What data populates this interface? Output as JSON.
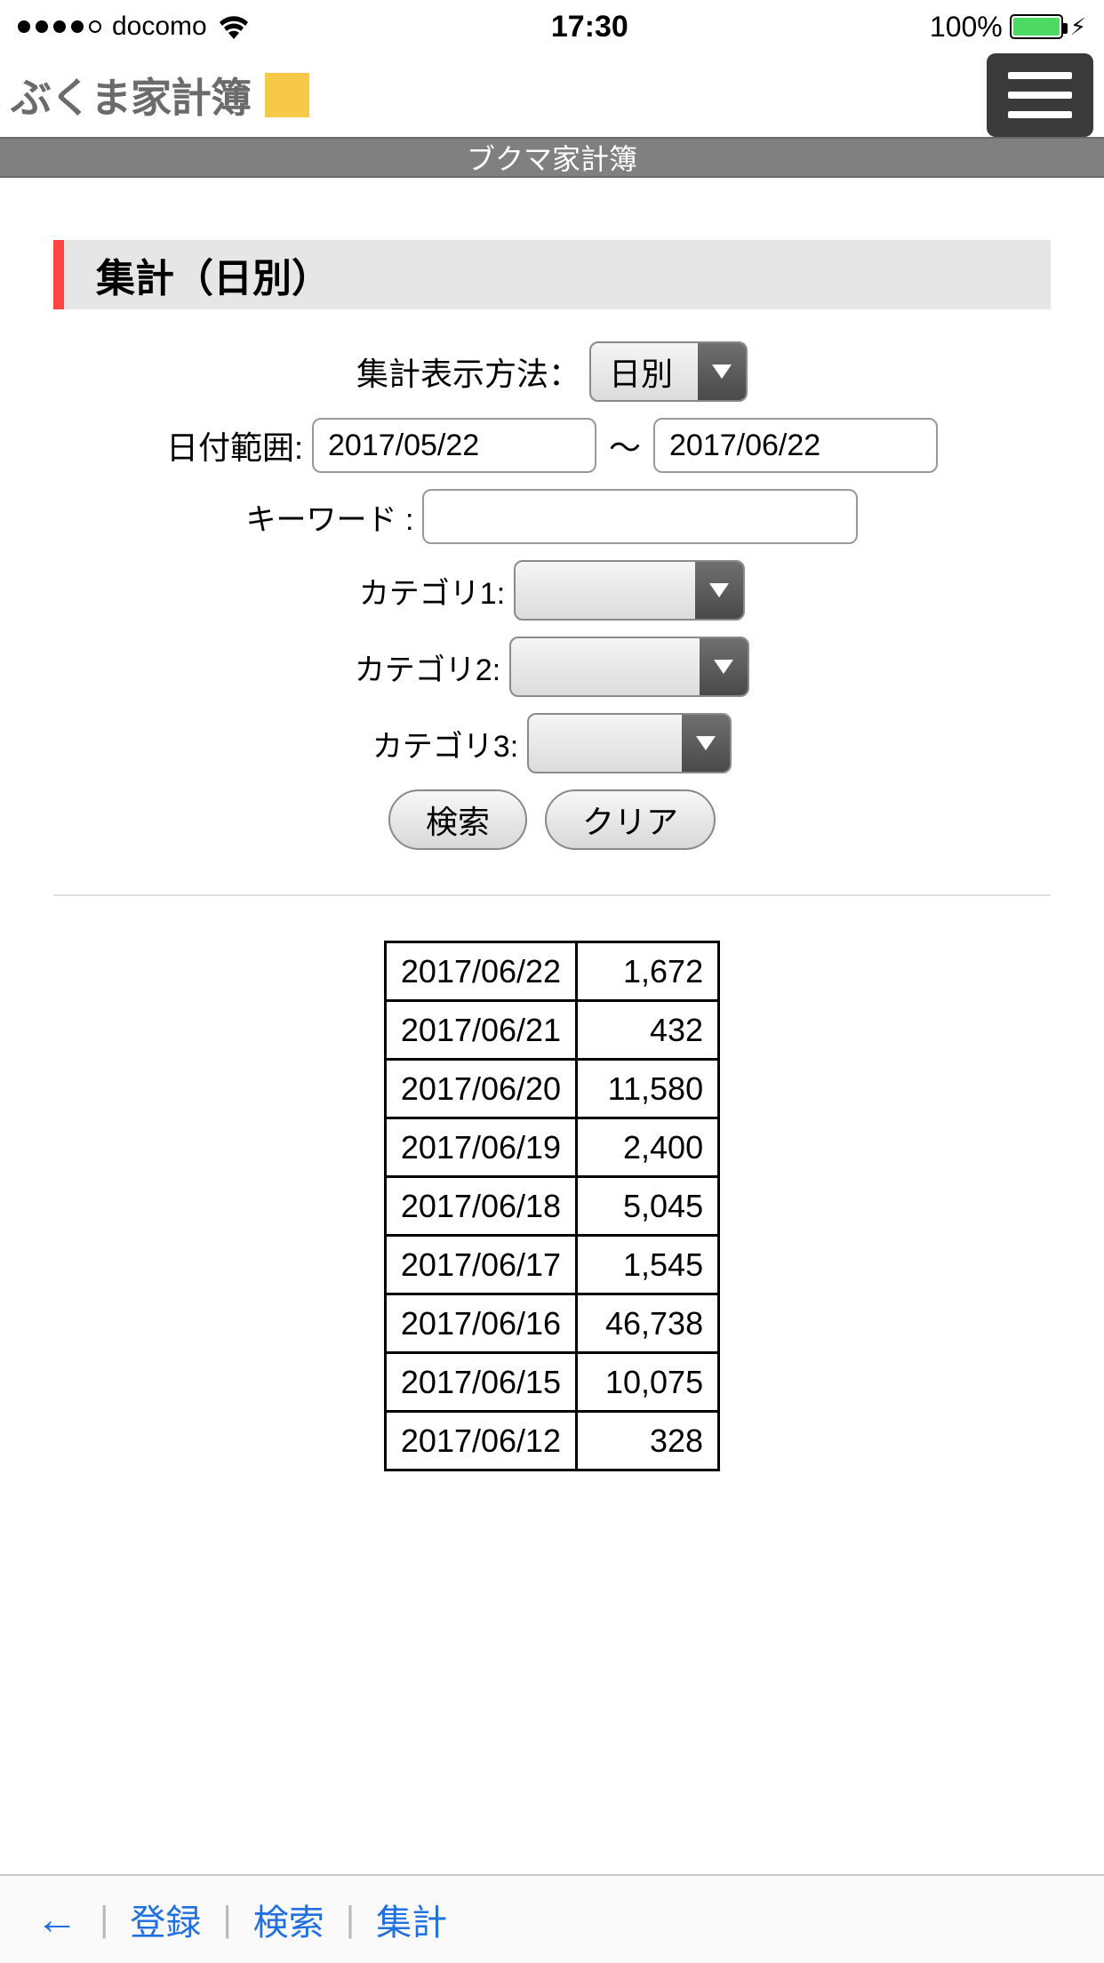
{
  "status": {
    "carrier": "docomo",
    "time": "17:30",
    "battery_pct": "100%"
  },
  "header": {
    "app_title": "ぶくま家計簿"
  },
  "gray_bar": {
    "title": "ブクマ家計簿"
  },
  "section": {
    "title": "集計（日別）"
  },
  "form": {
    "display_method_label": "集計表示方法：",
    "display_method_value": "日別",
    "date_range_label": "日付範囲:",
    "date_from": "2017/05/22",
    "date_tilde": "〜",
    "date_to": "2017/06/22",
    "keyword_label": "キーワード :",
    "keyword_value": "",
    "cat1_label": "カテゴリ1:",
    "cat1_value": "",
    "cat2_label": "カテゴリ2:",
    "cat2_value": "",
    "cat3_label": "カテゴリ3:",
    "cat3_value": "",
    "search_btn": "検索",
    "clear_btn": "クリア"
  },
  "table": {
    "rows": [
      {
        "date": "2017/06/22",
        "value": "1,672"
      },
      {
        "date": "2017/06/21",
        "value": "432"
      },
      {
        "date": "2017/06/20",
        "value": "11,580"
      },
      {
        "date": "2017/06/19",
        "value": "2,400"
      },
      {
        "date": "2017/06/18",
        "value": "5,045"
      },
      {
        "date": "2017/06/17",
        "value": "1,545"
      },
      {
        "date": "2017/06/16",
        "value": "46,738"
      },
      {
        "date": "2017/06/15",
        "value": "10,075"
      },
      {
        "date": "2017/06/12",
        "value": "328"
      }
    ]
  },
  "nav": {
    "back": "←",
    "register": "登録",
    "search": "検索",
    "summary": "集計",
    "sep": "|"
  }
}
